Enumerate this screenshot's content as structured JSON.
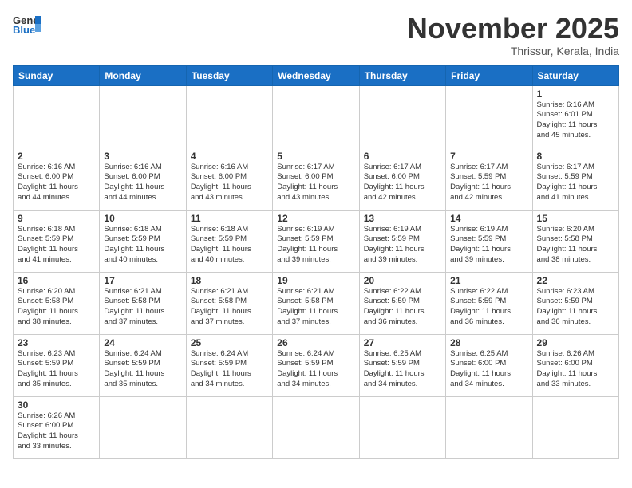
{
  "header": {
    "logo_general": "General",
    "logo_blue": "Blue",
    "month_title": "November 2025",
    "location": "Thrissur, Kerala, India"
  },
  "days_of_week": [
    "Sunday",
    "Monday",
    "Tuesday",
    "Wednesday",
    "Thursday",
    "Friday",
    "Saturday"
  ],
  "weeks": [
    [
      {
        "day": "",
        "info": ""
      },
      {
        "day": "",
        "info": ""
      },
      {
        "day": "",
        "info": ""
      },
      {
        "day": "",
        "info": ""
      },
      {
        "day": "",
        "info": ""
      },
      {
        "day": "",
        "info": ""
      },
      {
        "day": "1",
        "info": "Sunrise: 6:16 AM\nSunset: 6:01 PM\nDaylight: 11 hours\nand 45 minutes."
      }
    ],
    [
      {
        "day": "2",
        "info": "Sunrise: 6:16 AM\nSunset: 6:00 PM\nDaylight: 11 hours\nand 44 minutes."
      },
      {
        "day": "3",
        "info": "Sunrise: 6:16 AM\nSunset: 6:00 PM\nDaylight: 11 hours\nand 44 minutes."
      },
      {
        "day": "4",
        "info": "Sunrise: 6:16 AM\nSunset: 6:00 PM\nDaylight: 11 hours\nand 43 minutes."
      },
      {
        "day": "5",
        "info": "Sunrise: 6:17 AM\nSunset: 6:00 PM\nDaylight: 11 hours\nand 43 minutes."
      },
      {
        "day": "6",
        "info": "Sunrise: 6:17 AM\nSunset: 6:00 PM\nDaylight: 11 hours\nand 42 minutes."
      },
      {
        "day": "7",
        "info": "Sunrise: 6:17 AM\nSunset: 5:59 PM\nDaylight: 11 hours\nand 42 minutes."
      },
      {
        "day": "8",
        "info": "Sunrise: 6:17 AM\nSunset: 5:59 PM\nDaylight: 11 hours\nand 41 minutes."
      }
    ],
    [
      {
        "day": "9",
        "info": "Sunrise: 6:18 AM\nSunset: 5:59 PM\nDaylight: 11 hours\nand 41 minutes."
      },
      {
        "day": "10",
        "info": "Sunrise: 6:18 AM\nSunset: 5:59 PM\nDaylight: 11 hours\nand 40 minutes."
      },
      {
        "day": "11",
        "info": "Sunrise: 6:18 AM\nSunset: 5:59 PM\nDaylight: 11 hours\nand 40 minutes."
      },
      {
        "day": "12",
        "info": "Sunrise: 6:19 AM\nSunset: 5:59 PM\nDaylight: 11 hours\nand 39 minutes."
      },
      {
        "day": "13",
        "info": "Sunrise: 6:19 AM\nSunset: 5:59 PM\nDaylight: 11 hours\nand 39 minutes."
      },
      {
        "day": "14",
        "info": "Sunrise: 6:19 AM\nSunset: 5:59 PM\nDaylight: 11 hours\nand 39 minutes."
      },
      {
        "day": "15",
        "info": "Sunrise: 6:20 AM\nSunset: 5:58 PM\nDaylight: 11 hours\nand 38 minutes."
      }
    ],
    [
      {
        "day": "16",
        "info": "Sunrise: 6:20 AM\nSunset: 5:58 PM\nDaylight: 11 hours\nand 38 minutes."
      },
      {
        "day": "17",
        "info": "Sunrise: 6:21 AM\nSunset: 5:58 PM\nDaylight: 11 hours\nand 37 minutes."
      },
      {
        "day": "18",
        "info": "Sunrise: 6:21 AM\nSunset: 5:58 PM\nDaylight: 11 hours\nand 37 minutes."
      },
      {
        "day": "19",
        "info": "Sunrise: 6:21 AM\nSunset: 5:58 PM\nDaylight: 11 hours\nand 37 minutes."
      },
      {
        "day": "20",
        "info": "Sunrise: 6:22 AM\nSunset: 5:59 PM\nDaylight: 11 hours\nand 36 minutes."
      },
      {
        "day": "21",
        "info": "Sunrise: 6:22 AM\nSunset: 5:59 PM\nDaylight: 11 hours\nand 36 minutes."
      },
      {
        "day": "22",
        "info": "Sunrise: 6:23 AM\nSunset: 5:59 PM\nDaylight: 11 hours\nand 36 minutes."
      }
    ],
    [
      {
        "day": "23",
        "info": "Sunrise: 6:23 AM\nSunset: 5:59 PM\nDaylight: 11 hours\nand 35 minutes."
      },
      {
        "day": "24",
        "info": "Sunrise: 6:24 AM\nSunset: 5:59 PM\nDaylight: 11 hours\nand 35 minutes."
      },
      {
        "day": "25",
        "info": "Sunrise: 6:24 AM\nSunset: 5:59 PM\nDaylight: 11 hours\nand 34 minutes."
      },
      {
        "day": "26",
        "info": "Sunrise: 6:24 AM\nSunset: 5:59 PM\nDaylight: 11 hours\nand 34 minutes."
      },
      {
        "day": "27",
        "info": "Sunrise: 6:25 AM\nSunset: 5:59 PM\nDaylight: 11 hours\nand 34 minutes."
      },
      {
        "day": "28",
        "info": "Sunrise: 6:25 AM\nSunset: 6:00 PM\nDaylight: 11 hours\nand 34 minutes."
      },
      {
        "day": "29",
        "info": "Sunrise: 6:26 AM\nSunset: 6:00 PM\nDaylight: 11 hours\nand 33 minutes."
      }
    ],
    [
      {
        "day": "30",
        "info": "Sunrise: 6:26 AM\nSunset: 6:00 PM\nDaylight: 11 hours\nand 33 minutes."
      },
      {
        "day": "",
        "info": ""
      },
      {
        "day": "",
        "info": ""
      },
      {
        "day": "",
        "info": ""
      },
      {
        "day": "",
        "info": ""
      },
      {
        "day": "",
        "info": ""
      },
      {
        "day": "",
        "info": ""
      }
    ]
  ]
}
